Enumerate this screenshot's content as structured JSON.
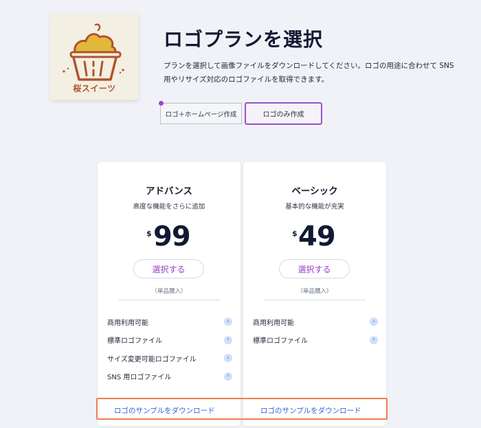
{
  "logo": {
    "text": "桜スイーツ",
    "brand_color": "#b0532d",
    "accent_color": "#e2b83a"
  },
  "header": {
    "title": "ロゴプランを選択",
    "description": "プランを選択して画像ファイルをダウンロードしてください。ロゴの用途に合わせて SNS 用やリサイズ対応のロゴファイルを取得できます。"
  },
  "toggle": {
    "left_label": "ロゴ＋ホームページ作成",
    "right_label": "ロゴのみ作成",
    "selected": "right"
  },
  "plans": [
    {
      "name": "アドバンス",
      "subtitle": "高度な機能をさらに追加",
      "currency": "$",
      "price": "99",
      "button_label": "選択する",
      "note": "（単品購入）",
      "features": [
        "商用利用可能",
        "標準ロゴファイル",
        "サイズ変更可能ロゴファイル",
        "SNS 用ロゴファイル"
      ],
      "download_label": "ロゴのサンプルをダウンロード"
    },
    {
      "name": "ベーシック",
      "subtitle": "基本的な機能が充実",
      "currency": "$",
      "price": "49",
      "button_label": "選択する",
      "note": "（単品購入）",
      "features": [
        "商用利用可能",
        "標準ロゴファイル"
      ],
      "download_label": "ロゴのサンプルをダウンロード"
    }
  ],
  "colors": {
    "accent_purple": "#9b3fc8",
    "link_blue": "#3466d6",
    "highlight_orange": "#f07d55"
  }
}
